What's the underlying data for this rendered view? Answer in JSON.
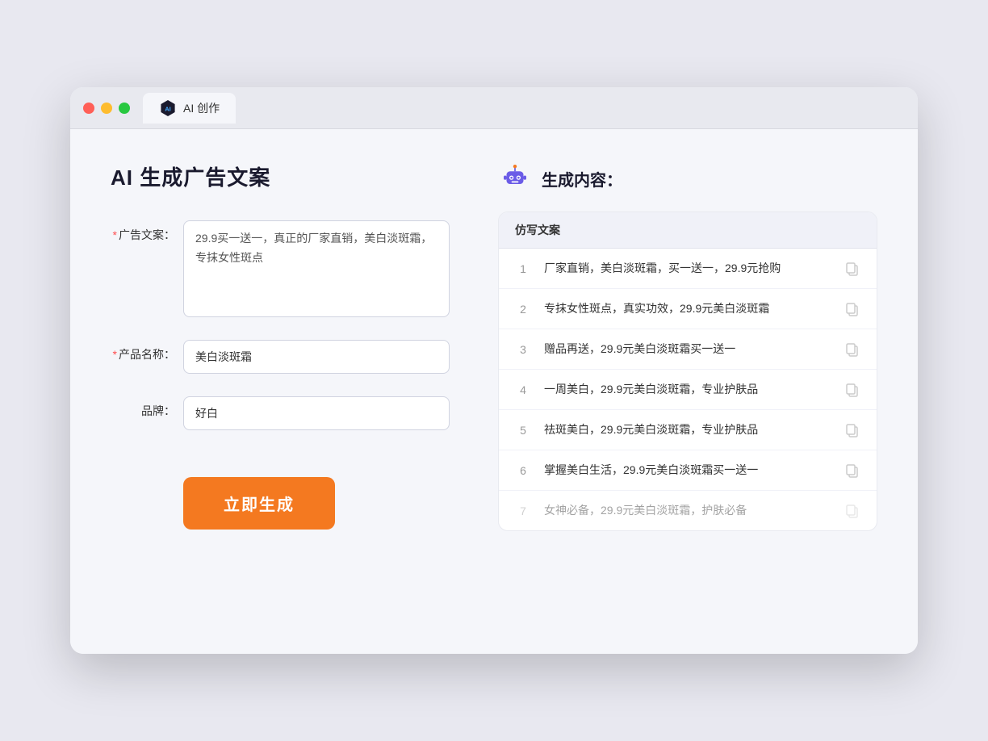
{
  "browser": {
    "tab_label": "AI 创作"
  },
  "page": {
    "title": "AI 生成广告文案",
    "result_title": "生成内容："
  },
  "form": {
    "ad_copy_label": "广告文案：",
    "ad_copy_required": "*",
    "ad_copy_value": "29.9买一送一，真正的厂家直销，美白淡斑霜，专抹女性斑点",
    "product_name_label": "产品名称：",
    "product_name_required": "*",
    "product_name_value": "美白淡斑霜",
    "brand_label": "品牌：",
    "brand_value": "好白",
    "submit_label": "立即生成"
  },
  "result": {
    "table_header": "仿写文案",
    "rows": [
      {
        "num": "1",
        "text": "厂家直销，美白淡斑霜，买一送一，29.9元抢购",
        "dimmed": false
      },
      {
        "num": "2",
        "text": "专抹女性斑点，真实功效，29.9元美白淡斑霜",
        "dimmed": false
      },
      {
        "num": "3",
        "text": "赠品再送，29.9元美白淡斑霜买一送一",
        "dimmed": false
      },
      {
        "num": "4",
        "text": "一周美白，29.9元美白淡斑霜，专业护肤品",
        "dimmed": false
      },
      {
        "num": "5",
        "text": "祛斑美白，29.9元美白淡斑霜，专业护肤品",
        "dimmed": false
      },
      {
        "num": "6",
        "text": "掌握美白生活，29.9元美白淡斑霜买一送一",
        "dimmed": false
      },
      {
        "num": "7",
        "text": "女神必备，29.9元美白淡斑霜，护肤必备",
        "dimmed": true
      }
    ]
  },
  "colors": {
    "accent": "#f47920",
    "primary": "#7b68ee",
    "required": "#ff4d4f"
  }
}
